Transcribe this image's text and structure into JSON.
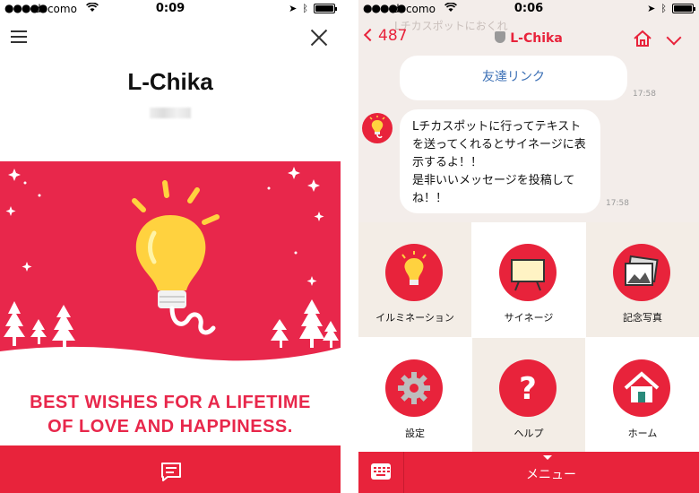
{
  "left": {
    "status": {
      "carrier": "docomo",
      "time": "0:09"
    },
    "title": "L-Chika",
    "card": {
      "message": [
        "BEST WISHES FOR A LIFETIME",
        "OF LOVE AND HAPPINESS."
      ],
      "colors": {
        "background": "#e8274b",
        "text": "#e8274b",
        "bulb": "#ffd23f"
      }
    },
    "icons": {
      "menu": "hamburger-icon",
      "close": "close-icon",
      "footer": "chat-icon"
    }
  },
  "right": {
    "status": {
      "carrier": "docomo",
      "time": "0:06"
    },
    "header": {
      "back_count": "487",
      "channel": "L-Chika",
      "ghost_title": "Lチカスポットにおくれ"
    },
    "messages": [
      {
        "text": "友達リンク",
        "time": "17:58"
      },
      {
        "text": "Lチカスポットに行ってテキストを送ってくれるとサイネージに表示するよ！！\n是非いいメッセージを投稿してね！！",
        "time": "17:58"
      }
    ],
    "menu": [
      {
        "label": "イルミネーション",
        "icon": "light-bulb-icon"
      },
      {
        "label": "サイネージ",
        "icon": "signage-board-icon"
      },
      {
        "label": "記念写真",
        "icon": "photo-icon"
      },
      {
        "label": "設定",
        "icon": "gear-icon"
      },
      {
        "label": "ヘルプ",
        "icon": "question-icon"
      },
      {
        "label": "ホーム",
        "icon": "house-icon"
      }
    ],
    "footer": {
      "menu_label": "メニュー"
    },
    "colors": {
      "accent": "#e8233b",
      "chat_bg": "#f3edea",
      "link": "#3b6fb5"
    }
  }
}
